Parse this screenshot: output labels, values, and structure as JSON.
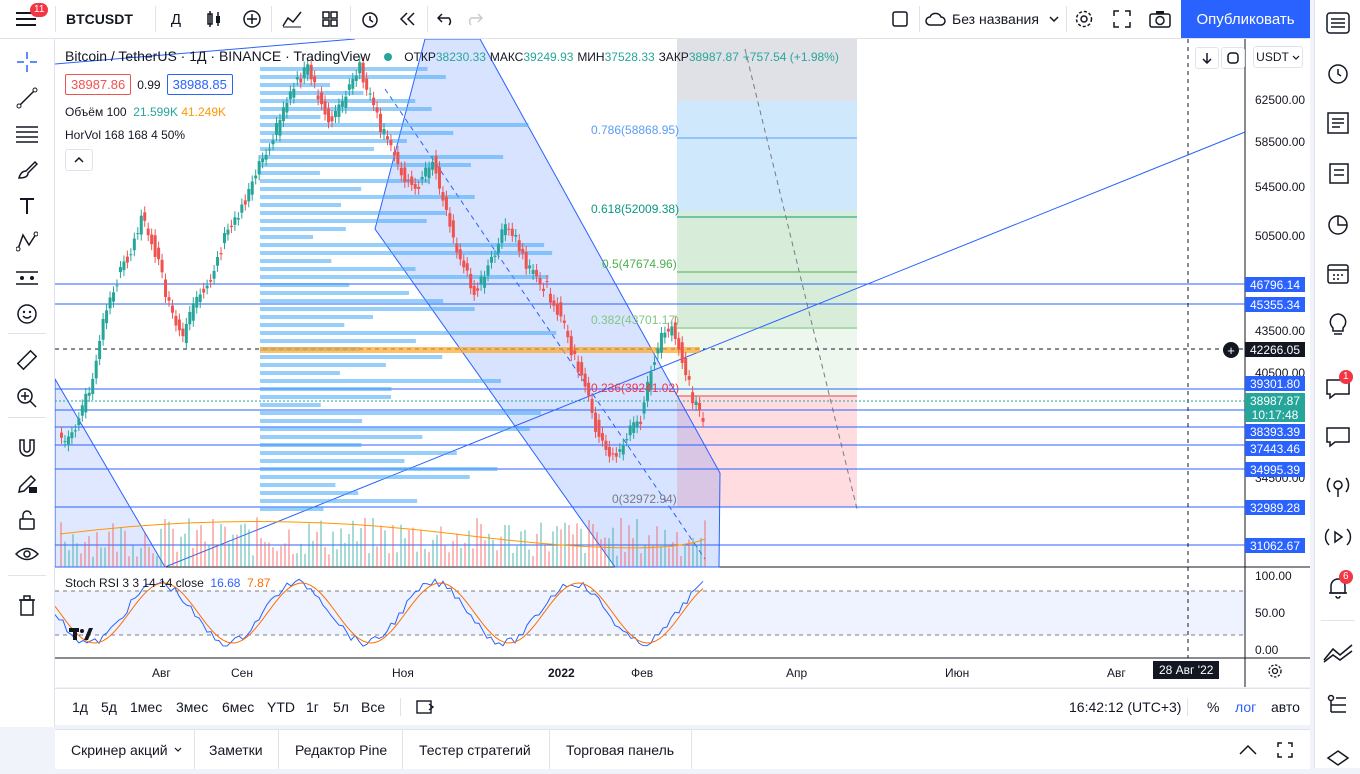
{
  "topbar": {
    "menu_badge": "11",
    "symbol": "BTCUSDT",
    "interval": "Д",
    "layout_name": "Без названия",
    "publish": "Опубликовать"
  },
  "legend": {
    "title": "Bitcoin / TetherUS · 1Д · BINANCE · TradingView",
    "open_label": "ОТКР",
    "open": "38230.33",
    "high_label": "МАКС",
    "high": "39249.93",
    "low_label": "МИН",
    "low": "37528.33",
    "close_label": "ЗАКР",
    "close": "38987.87",
    "change": "+757.54 (+1.98%)",
    "bid": "38987.86",
    "spread": "0.99",
    "ask": "38988.85",
    "volume": "Объём 100",
    "vol1": "21.599K",
    "vol2": "41.249K",
    "horvol": "HorVol 168 168 4 50%",
    "stoch": "Stoch RSI 3 3 14 14 close",
    "stoch_k": "16.68",
    "stoch_d": "7.87",
    "currency": "USDT"
  },
  "price_axis": [
    "62500.00",
    "58500.00",
    "54500.00",
    "50500.00",
    "43500.00",
    "40500.00",
    "34500.00"
  ],
  "price_boxes": [
    {
      "value": "46796.14",
      "color": "#2962ff"
    },
    {
      "value": "45355.34",
      "color": "#2962ff"
    },
    {
      "value": "42266.05",
      "color": "#131722"
    },
    {
      "value": "39301.80",
      "color": "#2962ff"
    },
    {
      "value": "38987.87",
      "color": "#26a69a"
    },
    {
      "value": "10:17:48",
      "color": "#26a69a"
    },
    {
      "value": "38393.39",
      "color": "#2962ff"
    },
    {
      "value": "37443.46",
      "color": "#2962ff"
    },
    {
      "value": "34995.39",
      "color": "#2962ff"
    },
    {
      "value": "32989.28",
      "color": "#2962ff"
    },
    {
      "value": "31062.67",
      "color": "#2962ff"
    }
  ],
  "fib": [
    {
      "label": "0.786(58868.95)",
      "color": "#5b9cf6"
    },
    {
      "label": "0.618(52009.38)",
      "color": "#089981"
    },
    {
      "label": "0.5(47674.96)",
      "color": "#4caf50"
    },
    {
      "label": "0.382(43701.17)",
      "color": "#81c784"
    },
    {
      "label": "0.236(39241.02)",
      "color": "#f23645"
    },
    {
      "label": "0(32972.94)",
      "color": "#787b86"
    }
  ],
  "stoch_axis": [
    "100.00",
    "50.00",
    "0.00"
  ],
  "time_axis": [
    "Авг",
    "Сен",
    "Ноя",
    "2022",
    "Фев",
    "Апр",
    "Июн",
    "Авг"
  ],
  "crosshair_date": "28 Авг '22",
  "ranges": [
    "1д",
    "5д",
    "1мес",
    "3мес",
    "6мес",
    "YTD",
    "1г",
    "5л",
    "Все"
  ],
  "clock": "16:42:12 (UTC+3)",
  "scale_opts": [
    "%",
    "лог",
    "авто"
  ],
  "panels": [
    "Скринер акций",
    "Заметки",
    "Редактор Pine",
    "Тестер стратегий",
    "Торговая панель"
  ],
  "right_badges": {
    "chat": "1",
    "alerts": "6"
  },
  "colors": {
    "accent": "#2962ff",
    "up": "#26a69a",
    "down": "#ef5350",
    "fib_channel": "#2962ff"
  }
}
